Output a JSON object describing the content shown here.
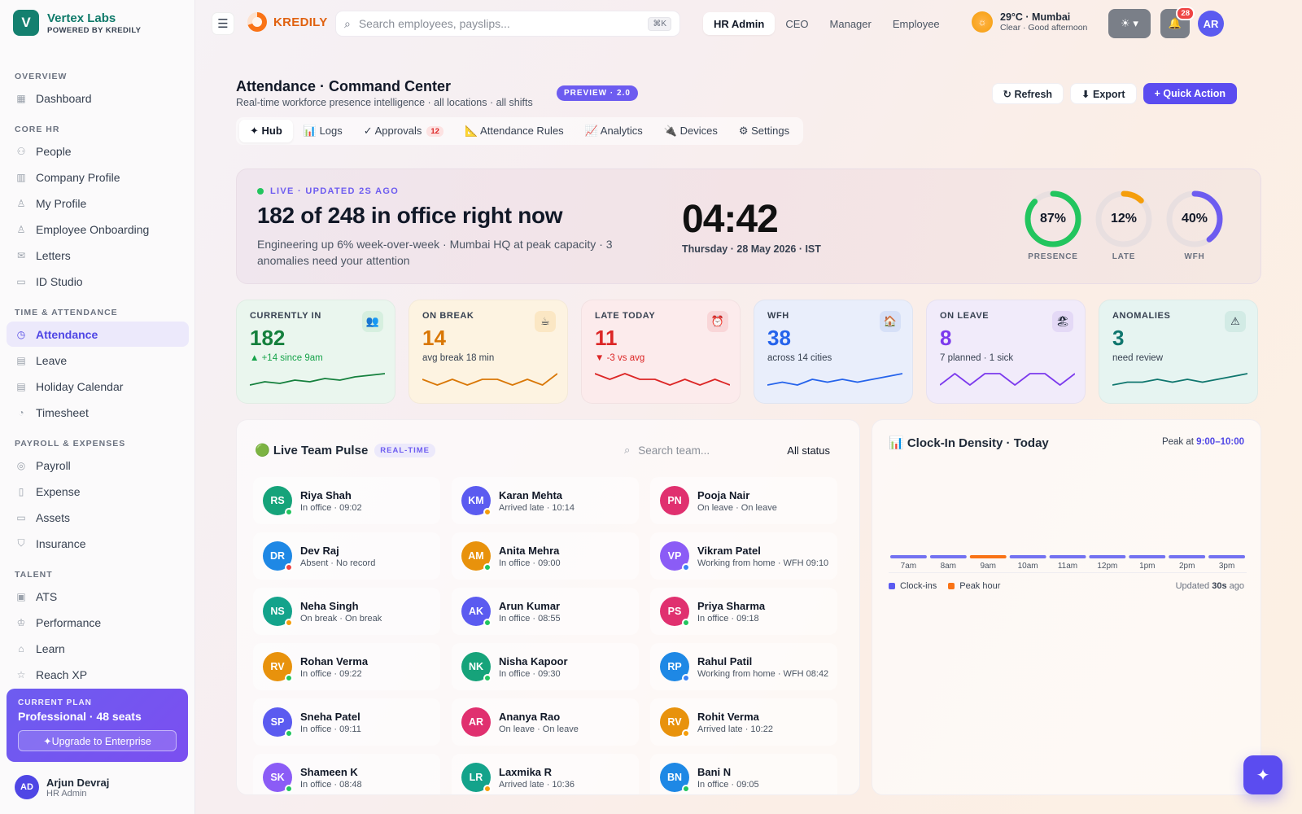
{
  "brand": {
    "logo_letter": "V",
    "name": "Vertex Labs",
    "sub": "POWERED BY KREDILY"
  },
  "nav": {
    "sections": [
      {
        "title": "OVERVIEW",
        "items": [
          {
            "label": "Dashboard",
            "icon": "grid-icon"
          }
        ]
      },
      {
        "title": "CORE HR",
        "items": [
          {
            "label": "People",
            "icon": "users-icon"
          },
          {
            "label": "Company Profile",
            "icon": "building-icon"
          },
          {
            "label": "My Profile",
            "icon": "user-icon"
          },
          {
            "label": "Employee Onboarding",
            "icon": "user-plus-icon"
          },
          {
            "label": "Letters",
            "icon": "mail-icon"
          },
          {
            "label": "ID Studio",
            "icon": "id-card-icon"
          }
        ]
      },
      {
        "title": "TIME & ATTENDANCE",
        "items": [
          {
            "label": "Attendance",
            "icon": "clock-icon",
            "active": true
          },
          {
            "label": "Leave",
            "icon": "calendar-icon"
          },
          {
            "label": "Holiday Calendar",
            "icon": "calendar-days-icon"
          },
          {
            "label": "Timesheet",
            "icon": "timer-icon"
          }
        ]
      },
      {
        "title": "PAYROLL & EXPENSES",
        "items": [
          {
            "label": "Payroll",
            "icon": "coin-icon"
          },
          {
            "label": "Expense",
            "icon": "receipt-icon"
          },
          {
            "label": "Assets",
            "icon": "monitor-icon"
          },
          {
            "label": "Insurance",
            "icon": "shield-icon"
          }
        ]
      },
      {
        "title": "TALENT",
        "items": [
          {
            "label": "ATS",
            "icon": "briefcase-icon"
          },
          {
            "label": "Performance",
            "icon": "trophy-icon"
          },
          {
            "label": "Learn",
            "icon": "graduation-icon"
          },
          {
            "label": "Reach XP",
            "icon": "star-icon"
          }
        ]
      }
    ]
  },
  "plan": {
    "label": "CURRENT PLAN",
    "name": "Professional · 48 seats",
    "cta": "✦Upgrade to Enterprise"
  },
  "user": {
    "initials": "AD",
    "name": "Arjun Devraj",
    "role": "HR Admin"
  },
  "topbar": {
    "product": "KREDILY",
    "search_placeholder": "Search employees, payslips...",
    "shortcut": "⌘K",
    "roles": [
      {
        "label": "HR Admin",
        "active": true
      },
      {
        "label": "CEO"
      },
      {
        "label": "Manager"
      },
      {
        "label": "Employee"
      }
    ],
    "weather_main": "29°C · Mumbai",
    "weather_sub": "Clear · Good afternoon",
    "notif_count": "28",
    "avatar": "AR"
  },
  "header": {
    "title": "Attendance · Command Center",
    "subtitle": "Real-time workforce presence intelligence · all locations · all shifts",
    "badge": "PREVIEW · 2.0",
    "actions": {
      "refresh": "↻ Refresh",
      "export": "⬇ Export",
      "quick": "+ Quick Action"
    },
    "tabs": [
      {
        "label": "✦ Hub",
        "active": true
      },
      {
        "label": "📊 Logs"
      },
      {
        "label": "✓ Approvals",
        "count": "12"
      },
      {
        "label": "📐 Attendance Rules"
      },
      {
        "label": "📈 Analytics"
      },
      {
        "label": "🔌 Devices"
      },
      {
        "label": "⚙ Settings"
      }
    ]
  },
  "hero": {
    "live": "LIVE · UPDATED  2S  AGO",
    "title": "182 of 248 in office right now",
    "desc": "Engineering up 6% week-over-week · Mumbai HQ at peak capacity · 3 anomalies need your attention",
    "time": "04:42",
    "date": "Thursday · 28 May 2026 · IST",
    "rings": [
      {
        "label": "PRESENCE",
        "value": "87%",
        "fraction": 0.87,
        "color": "#22c55e"
      },
      {
        "label": "LATE",
        "value": "12%",
        "fraction": 0.12,
        "color": "#f59e0b"
      },
      {
        "label": "WFH",
        "value": "40%",
        "fraction": 0.4,
        "color": "#6d5cf0"
      }
    ]
  },
  "kpis": [
    {
      "label": "CURRENTLY IN",
      "value": "182",
      "sub": "▲ +14 since 9am",
      "color": "#15803d",
      "sub_color": "#16a34a",
      "bg": "#eaf6ee",
      "icon": "👥",
      "icon_name": "users-icon",
      "icon_bg": "#d6efdf",
      "spark": [
        4,
        6,
        5,
        7,
        6,
        8,
        7,
        9,
        10,
        11
      ]
    },
    {
      "label": "ON BREAK",
      "value": "14",
      "sub": "avg break 18 min",
      "color": "#d97706",
      "sub_color": "#374151",
      "bg": "#fdf3e1",
      "icon": "☕",
      "icon_name": "coffee-icon",
      "icon_bg": "#fbe7c4",
      "spark": [
        6,
        5,
        6,
        5,
        6,
        6,
        5,
        6,
        5,
        7
      ]
    },
    {
      "label": "LATE TODAY",
      "value": "11",
      "sub": "▼ -3 vs avg",
      "color": "#dc2626",
      "sub_color": "#dc2626",
      "bg": "#fcebec",
      "icon": "⏰",
      "icon_name": "alarm-icon",
      "icon_bg": "#f9d6d8",
      "spark": [
        7,
        6,
        7,
        6,
        6,
        5,
        6,
        5,
        6,
        5
      ]
    },
    {
      "label": "WFH",
      "value": "38",
      "sub": "across 14 cities",
      "color": "#2563eb",
      "sub_color": "#374151",
      "bg": "#e9eefb",
      "icon": "🏠",
      "icon_name": "home-icon",
      "icon_bg": "#d6e0f7",
      "spark": [
        5,
        6,
        5,
        7,
        6,
        7,
        6,
        7,
        8,
        9
      ]
    },
    {
      "label": "ON LEAVE",
      "value": "8",
      "sub": "7 planned · 1 sick",
      "color": "#7c3aed",
      "sub_color": "#374151",
      "bg": "#f1ebfa",
      "icon": "🏖",
      "icon_name": "beach-icon",
      "icon_bg": "#e4d9f6",
      "spark": [
        5,
        6,
        5,
        6,
        6,
        5,
        6,
        6,
        5,
        6
      ]
    },
    {
      "label": "ANOMALIES",
      "value": "3",
      "sub": "need review",
      "color": "#0f766e",
      "sub_color": "#374151",
      "bg": "#e6f4f1",
      "icon": "⚠",
      "icon_name": "warning-icon",
      "icon_bg": "#d2ebe5",
      "spark": [
        5,
        6,
        6,
        7,
        6,
        7,
        6,
        7,
        8,
        9
      ]
    }
  ],
  "pulse": {
    "title": "🟢 Live Team Pulse",
    "badge": "REAL-TIME",
    "search_placeholder": "Search team...",
    "status_filter": "All status",
    "members": [
      {
        "initials": "RS",
        "name": "Riya Shah",
        "status": "In office · 09:02",
        "color": "#16a37a",
        "dot": "#22c55e"
      },
      {
        "initials": "KM",
        "name": "Karan Mehta",
        "status": "Arrived late · 10:14",
        "color": "#5b5bf0",
        "dot": "#f59e0b"
      },
      {
        "initials": "PN",
        "name": "Pooja Nair",
        "status": "On leave · On leave",
        "color": "#e0306f",
        "dot": ""
      },
      {
        "initials": "DR",
        "name": "Dev Raj",
        "status": "Absent · No record",
        "color": "#1e88e5",
        "dot": "#ef4444"
      },
      {
        "initials": "AM",
        "name": "Anita Mehra",
        "status": "In office · 09:00",
        "color": "#e8920c",
        "dot": "#22c55e"
      },
      {
        "initials": "VP",
        "name": "Vikram Patel",
        "status": "Working from home · WFH 09:10",
        "color": "#8b5cf6",
        "dot": "#3b82f6"
      },
      {
        "initials": "NS",
        "name": "Neha Singh",
        "status": "On break · On break",
        "color": "#14a38b",
        "dot": "#f59e0b"
      },
      {
        "initials": "AK",
        "name": "Arun Kumar",
        "status": "In office · 08:55",
        "color": "#5b5bf0",
        "dot": "#22c55e"
      },
      {
        "initials": "PS",
        "name": "Priya Sharma",
        "status": "In office · 09:18",
        "color": "#e0306f",
        "dot": "#22c55e"
      },
      {
        "initials": "RV",
        "name": "Rohan Verma",
        "status": "In office · 09:22",
        "color": "#e8920c",
        "dot": "#22c55e"
      },
      {
        "initials": "NK",
        "name": "Nisha Kapoor",
        "status": "In office · 09:30",
        "color": "#16a37a",
        "dot": "#22c55e"
      },
      {
        "initials": "RP",
        "name": "Rahul Patil",
        "status": "Working from home · WFH 08:42",
        "color": "#1e88e5",
        "dot": "#3b82f6"
      },
      {
        "initials": "SP",
        "name": "Sneha Patel",
        "status": "In office · 09:11",
        "color": "#5b5bf0",
        "dot": "#22c55e"
      },
      {
        "initials": "AR",
        "name": "Ananya Rao",
        "status": "On leave · On leave",
        "color": "#e0306f",
        "dot": ""
      },
      {
        "initials": "RV",
        "name": "Rohit Verma",
        "status": "Arrived late · 10:22",
        "color": "#e8920c",
        "dot": "#f59e0b"
      },
      {
        "initials": "SK",
        "name": "Shameen K",
        "status": "In office · 08:48",
        "color": "#8b5cf6",
        "dot": "#22c55e"
      },
      {
        "initials": "LR",
        "name": "Laxmika R",
        "status": "Arrived late · 10:36",
        "color": "#14a38b",
        "dot": "#f59e0b"
      },
      {
        "initials": "BN",
        "name": "Bani N",
        "status": "In office · 09:05",
        "color": "#1e88e5",
        "dot": "#22c55e"
      }
    ]
  },
  "density": {
    "title": "📊 Clock-In Density · Today",
    "peak_prefix": "Peak at",
    "peak_value": "9:00–10:00",
    "legend": [
      {
        "label": "Clock-ins",
        "color": "#5b5bf0"
      },
      {
        "label": "Peak hour",
        "color": "#f97316"
      }
    ],
    "updated_prefix": "Updated",
    "updated_value": "30s",
    "updated_suffix": "ago"
  },
  "chart_data": {
    "type": "bar",
    "categories": [
      "7am",
      "8am",
      "9am",
      "10am",
      "11am",
      "12pm",
      "1pm",
      "2pm",
      "3pm"
    ],
    "values": [
      0,
      0,
      0,
      0,
      0,
      0,
      0,
      0,
      0
    ],
    "peak_index": 2,
    "title": "Clock-In Density · Today"
  }
}
